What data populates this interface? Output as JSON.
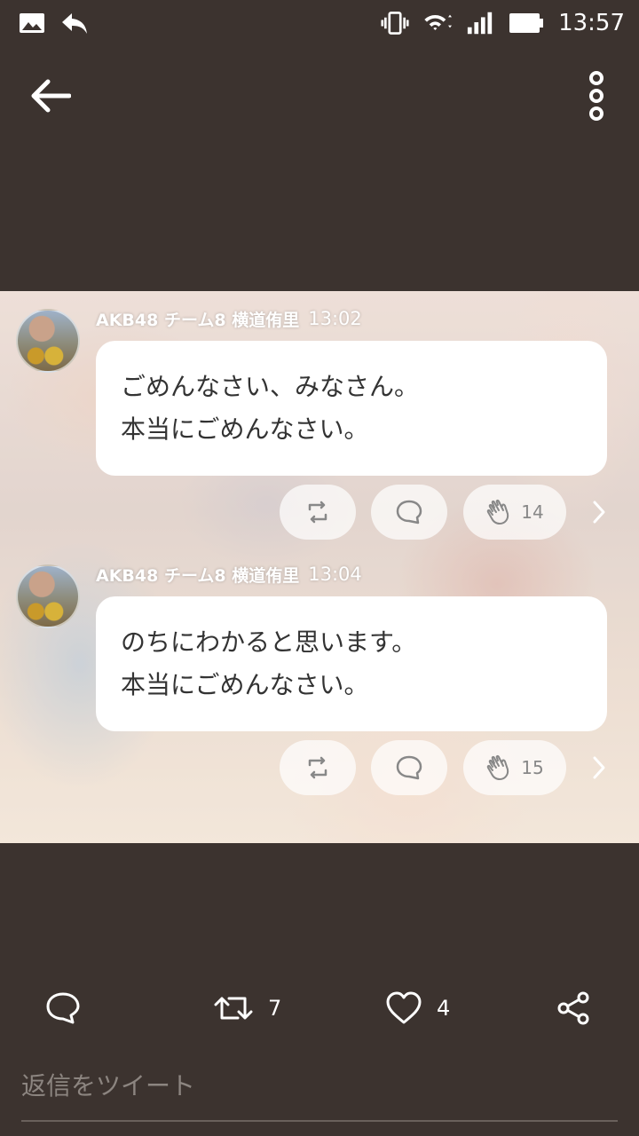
{
  "status_bar": {
    "time": "13:57",
    "left_icons": [
      "image-notification-icon",
      "reply-notification-icon"
    ],
    "right_icons": [
      "vibrate-icon",
      "wifi-icon",
      "signal-icon",
      "battery-icon"
    ]
  },
  "app_bar": {
    "back_icon": "arrow-left-icon",
    "menu_icon": "more-vertical-icon"
  },
  "image_posts": [
    {
      "author": "AKB48 チーム8 横道侑里",
      "time": "13:02",
      "line1": "ごめんなさい、みなさん。",
      "line2": "本当にごめんなさい。",
      "clap_count": "14"
    },
    {
      "author": "AKB48 チーム8 横道侑里",
      "time": "13:04",
      "line1": "のちにわかると思います。",
      "line2": "本当にごめんなさい。",
      "clap_count": "15"
    }
  ],
  "tweet_actions": {
    "retweet_count": "7",
    "like_count": "4"
  },
  "reply": {
    "placeholder": "返信をツイート"
  },
  "colors": {
    "background": "#3c332f",
    "bubble": "#ffffff",
    "text_dark": "#333333"
  }
}
